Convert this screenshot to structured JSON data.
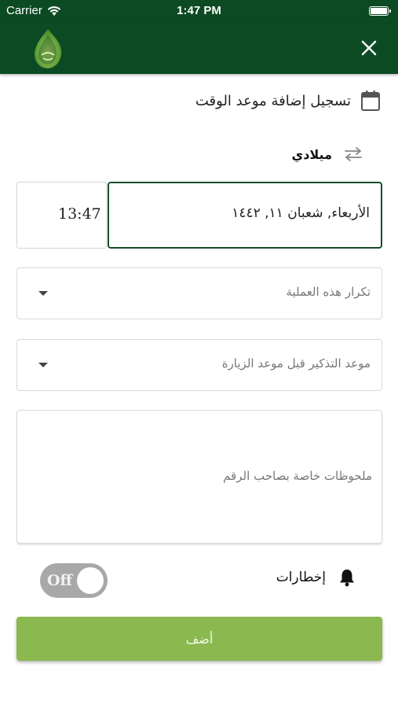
{
  "status_bar": {
    "carrier": "Carrier",
    "time": "1:47 PM"
  },
  "app_bar": {
    "background_color": "#0b4a22",
    "logo_icon": "leaf-logo-icon",
    "close_icon": "close-icon"
  },
  "form": {
    "title": "تسجيل إضافة موعد الوقت",
    "title_icon": "calendar-icon",
    "calendar_type_label": "ميلادي",
    "calendar_switch_icon": "swap-arrows-icon",
    "date_value": "الأربعاء, شعبان ١١, ١٤٤٢",
    "time_value": "13:47",
    "repeat_placeholder": "تكرار هذه العملية",
    "reminder_placeholder": "موعد التذكير قبل موعد الزيارة",
    "notes_placeholder": "ملحوظات خاصة بصاحب الرقم",
    "notifications_label": "إخطارات",
    "notifications_icon": "bell-icon",
    "notifications_toggle_label": "Off",
    "notifications_enabled": false,
    "add_button_label": "أضف",
    "accent_color": "#8bb84f"
  }
}
